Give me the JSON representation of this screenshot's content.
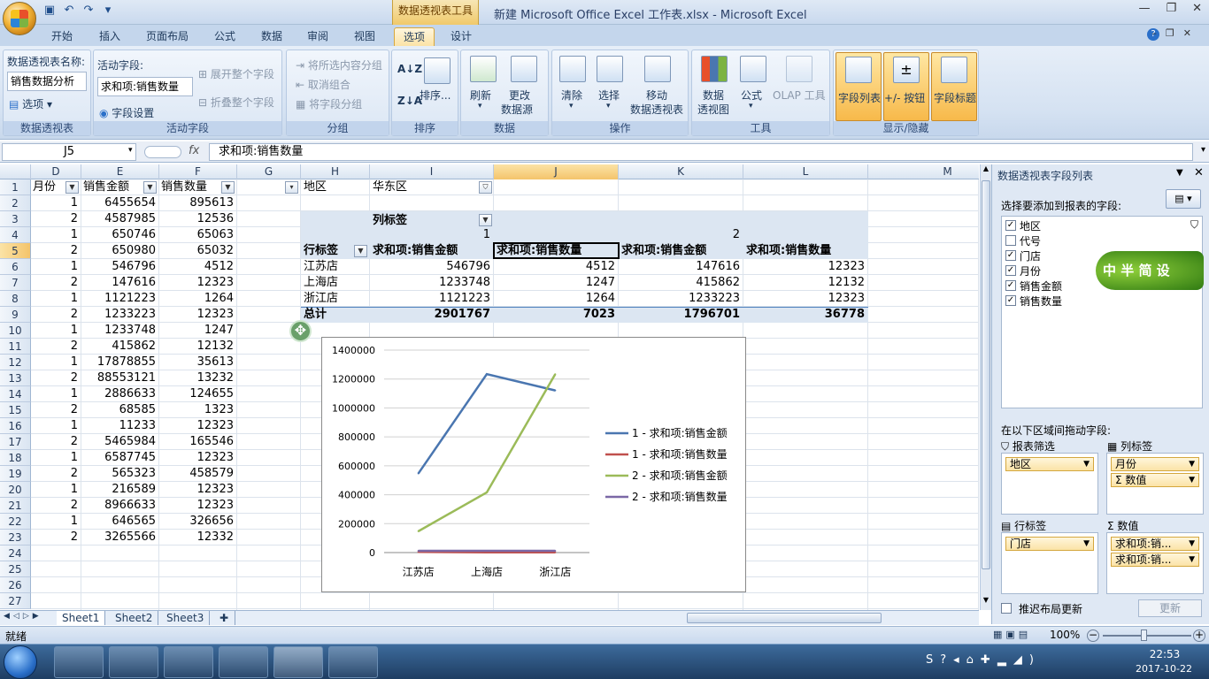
{
  "titlebar": {
    "context_tab": "数据透视表工具",
    "window_title": "新建 Microsoft Office Excel 工作表.xlsx - Microsoft Excel"
  },
  "tabs": [
    "开始",
    "插入",
    "页面布局",
    "公式",
    "数据",
    "审阅",
    "视图",
    "选项",
    "设计"
  ],
  "ribbon": {
    "pivot_name_label": "数据透视表名称:",
    "pivot_name_value": "销售数据分析",
    "options_label": "选项",
    "group_pivot": "数据透视表",
    "active_field_label": "活动字段:",
    "active_field_value": "求和项:销售数量",
    "field_settings": "字段设置",
    "expand_field": "展开整个字段",
    "collapse_field": "折叠整个字段",
    "group_active": "活动字段",
    "group_selection": "将所选内容分组",
    "ungroup": "取消组合",
    "group_field": "将字段分组",
    "group_group": "分组",
    "sort_label": "排序...",
    "group_sort": "排序",
    "refresh": "刷新",
    "change_source_1": "更改",
    "change_source_2": "数据源",
    "group_data": "数据",
    "clear": "清除",
    "select": "选择",
    "move_1": "移动",
    "move_2": "数据透视表",
    "group_actions": "操作",
    "pivot_chart_1": "数据",
    "pivot_chart_2": "透视图",
    "formulas": "公式",
    "olap": "OLAP 工具",
    "group_tools": "工具",
    "field_list": "字段列表",
    "plus_minus": "+/- 按钮",
    "field_headers": "字段标题",
    "group_show": "显示/隐藏"
  },
  "formula_bar": {
    "name_box": "J5",
    "fx": "fx",
    "formula": "求和项:销售数量"
  },
  "columns": [
    "D",
    "E",
    "F",
    "G",
    "H",
    "I",
    "J",
    "K",
    "L",
    "M"
  ],
  "rows": [
    "1",
    "2",
    "3",
    "4",
    "5",
    "6",
    "7",
    "8",
    "9",
    "10",
    "11",
    "12",
    "13",
    "14",
    "15",
    "16",
    "17",
    "18",
    "19",
    "20",
    "21",
    "22",
    "23",
    "24",
    "25",
    "26",
    "27"
  ],
  "source_headers": [
    "月份",
    "销售金额",
    "销售数量"
  ],
  "source_data": [
    [
      "1",
      "6455654",
      "895613"
    ],
    [
      "2",
      "4587985",
      "12536"
    ],
    [
      "1",
      "650746",
      "65063"
    ],
    [
      "2",
      "650980",
      "65032"
    ],
    [
      "1",
      "546796",
      "4512"
    ],
    [
      "2",
      "147616",
      "12323"
    ],
    [
      "1",
      "1121223",
      "1264"
    ],
    [
      "2",
      "1233223",
      "12323"
    ],
    [
      "1",
      "1233748",
      "1247"
    ],
    [
      "2",
      "415862",
      "12132"
    ],
    [
      "1",
      "17878855",
      "35613"
    ],
    [
      "2",
      "88553121",
      "13232"
    ],
    [
      "1",
      "2886633",
      "124655"
    ],
    [
      "2",
      "68585",
      "1323"
    ],
    [
      "1",
      "11233",
      "12323"
    ],
    [
      "2",
      "5465984",
      "165546"
    ],
    [
      "1",
      "6587745",
      "12323"
    ],
    [
      "2",
      "565323",
      "458579"
    ],
    [
      "1",
      "216589",
      "12323"
    ],
    [
      "2",
      "8966633",
      "12323"
    ],
    [
      "1",
      "646565",
      "326656"
    ],
    [
      "2",
      "3265566",
      "12332"
    ]
  ],
  "pivot": {
    "filter_label": "地区",
    "filter_value": "华东区",
    "col_label": "列标签",
    "row_label": "行标签",
    "col_groups": [
      "1",
      "2"
    ],
    "headers": [
      "求和项:销售金额",
      "求和项:销售数量",
      "求和项:销售金额",
      "求和项:销售数量"
    ],
    "rows": [
      {
        "name": "江苏店",
        "values": [
          "546796",
          "4512",
          "147616",
          "12323"
        ]
      },
      {
        "name": "上海店",
        "values": [
          "1233748",
          "1247",
          "415862",
          "12132"
        ]
      },
      {
        "name": "浙江店",
        "values": [
          "1121223",
          "1264",
          "1233223",
          "12323"
        ]
      }
    ],
    "total": {
      "name": "总计",
      "values": [
        "2901767",
        "7023",
        "1796701",
        "36778"
      ]
    }
  },
  "chart_data": {
    "type": "line",
    "categories": [
      "江苏店",
      "上海店",
      "浙江店"
    ],
    "ylim": [
      0,
      1400000
    ],
    "yticks": [
      "0",
      "200000",
      "400000",
      "600000",
      "800000",
      "1000000",
      "1200000",
      "1400000"
    ],
    "series": [
      {
        "name": "1 - 求和项:销售金额",
        "color": "#4a76b0",
        "values": [
          546796,
          1233748,
          1121223
        ]
      },
      {
        "name": "1 - 求和项:销售数量",
        "color": "#c0504d",
        "values": [
          4512,
          1247,
          1264
        ]
      },
      {
        "name": "2 - 求和项:销售金额",
        "color": "#9bbb59",
        "values": [
          147616,
          415862,
          1233223
        ]
      },
      {
        "name": "2 - 求和项:销售数量",
        "color": "#7b68a6",
        "values": [
          12323,
          12132,
          12323
        ]
      }
    ],
    "legend": "right"
  },
  "sheets": [
    "Sheet1",
    "Sheet2",
    "Sheet3"
  ],
  "status": {
    "ready": "就绪",
    "zoom": "100%"
  },
  "panel": {
    "title": "数据透视表字段列表",
    "choose_label": "选择要添加到报表的字段:",
    "fields": [
      {
        "name": "地区",
        "checked": true
      },
      {
        "name": "代号",
        "checked": false
      },
      {
        "name": "门店",
        "checked": true
      },
      {
        "name": "月份",
        "checked": true
      },
      {
        "name": "销售金额",
        "checked": true
      },
      {
        "name": "销售数量",
        "checked": true
      }
    ],
    "drag_label": "在以下区域间拖动字段:",
    "report_filter": "报表筛选",
    "col_labels": "列标签",
    "row_labels": "行标签",
    "values": "数值",
    "filter_items": [
      "地区"
    ],
    "col_items": [
      "月份",
      "数值"
    ],
    "row_items": [
      "门店"
    ],
    "value_items": [
      "求和项:销...",
      "求和项:销..."
    ],
    "defer_label": "推迟布局更新",
    "update_btn": "更新",
    "watermark": "中 半 简 设"
  },
  "clock": {
    "time": "22:53",
    "date": "2017-10-22"
  }
}
